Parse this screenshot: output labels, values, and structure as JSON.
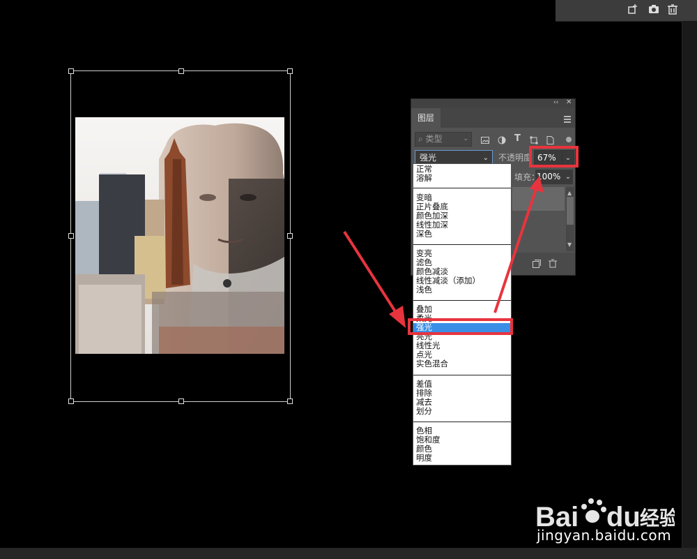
{
  "layers_panel": {
    "tab_label": "图层",
    "filter_placeholder": "类型",
    "blend_mode_selected": "强光",
    "opacity_label": "不透明度",
    "opacity_value": "67%",
    "fill_label": "填充",
    "fill_value": "100%"
  },
  "blend_modes": {
    "groups": [
      [
        "正常",
        "溶解"
      ],
      [
        "变暗",
        "正片叠底",
        "颜色加深",
        "线性加深",
        "深色"
      ],
      [
        "变亮",
        "滤色",
        "颜色减淡",
        "线性减淡（添加）",
        "浅色"
      ],
      [
        "叠加",
        "柔光",
        "强光",
        "亮光",
        "线性光",
        "点光",
        "实色混合"
      ],
      [
        "差值",
        "排除",
        "减去",
        "划分"
      ],
      [
        "色相",
        "饱和度",
        "颜色",
        "明度"
      ]
    ],
    "selected": "强光"
  },
  "annotation_color": "#e8343e",
  "selection_color": "#3a8ee6",
  "icons": [
    "add-layer-icon",
    "camera-icon",
    "trash-icon",
    "image-filter-icon",
    "adjustment-filter-icon",
    "text-filter-icon",
    "shape-filter-icon",
    "smart-object-filter-icon",
    "panel-menu-icon",
    "new-layer-icon",
    "delete-layer-icon"
  ],
  "watermark": {
    "brand": "Bai du 经验",
    "url": "jingyan.baidu.com"
  }
}
